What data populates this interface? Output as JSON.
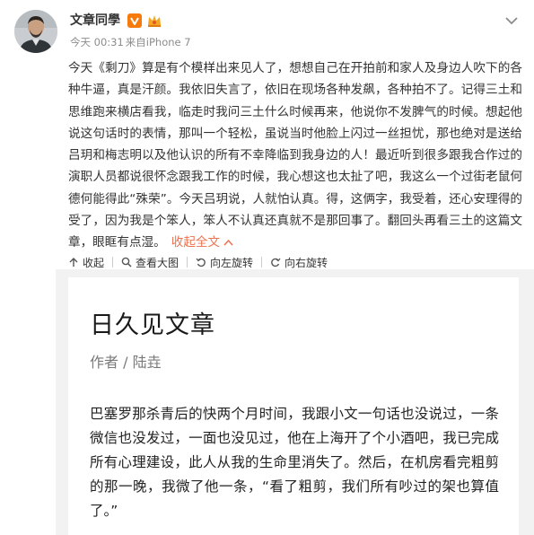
{
  "author": {
    "name": "文章同學",
    "verified_icon": "verified-v-icon",
    "member_icon": "member-crown-icon"
  },
  "meta": {
    "time": "今天 00:31",
    "source": "来自iPhone 7"
  },
  "post": {
    "text": "今天《剩刀》算是有个模样出来见人了，想想自己在开拍前和家人及身边人吹下的各种牛逼，真是汗颜。我依旧失言了，依旧在现场各种发飙，各种拍不了。记得三土和思维跑来横店看我，临走时我问三土什么时候再来，他说你不发脾气的时候。想起他说这句话时的表情，那叫一个轻松，虽说当时他脸上闪过一丝担忧，那也绝对是送给吕玥和梅志明以及他认识的所有不幸降临到我身边的人！最近听到很多跟我合作过的演职人员都说很怀念跟我工作的时候，我心想这也太扯了吧，我这么一个过街老鼠何德何能得此“殊荣”。今天吕玥说，人就怕认真。得，这俩字，我受着，还心安理得的受了，因为我是个笨人，笨人不认真还真就不是那回事了。翻回头再看三土的这篇文章，眼眶有点湿。",
    "collapse_label": "收起全文"
  },
  "toolbar": {
    "collapse": "收起",
    "view_large": "查看大图",
    "rotate_left": "向左旋转",
    "rotate_right": "向右旋转"
  },
  "article": {
    "title": "日久见文章",
    "byline": "作者 / 陆垚",
    "body": "巴塞罗那杀青后的快两个月时间，我跟小文一句话也没说过，一条微信也没发过，一面也没见过，他在上海开了个小酒吧，我已完成所有心理建设，此人从我的生命里消失了。然后，在机房看完粗剪的那一晚，我微了他一条，“看了粗剪，我们所有吵过的架也算值了。”"
  },
  "colors": {
    "link": "#eb7350",
    "badge": "#f77a0c",
    "meta": "#8c8c8c",
    "panel": "#f2f2f2"
  }
}
